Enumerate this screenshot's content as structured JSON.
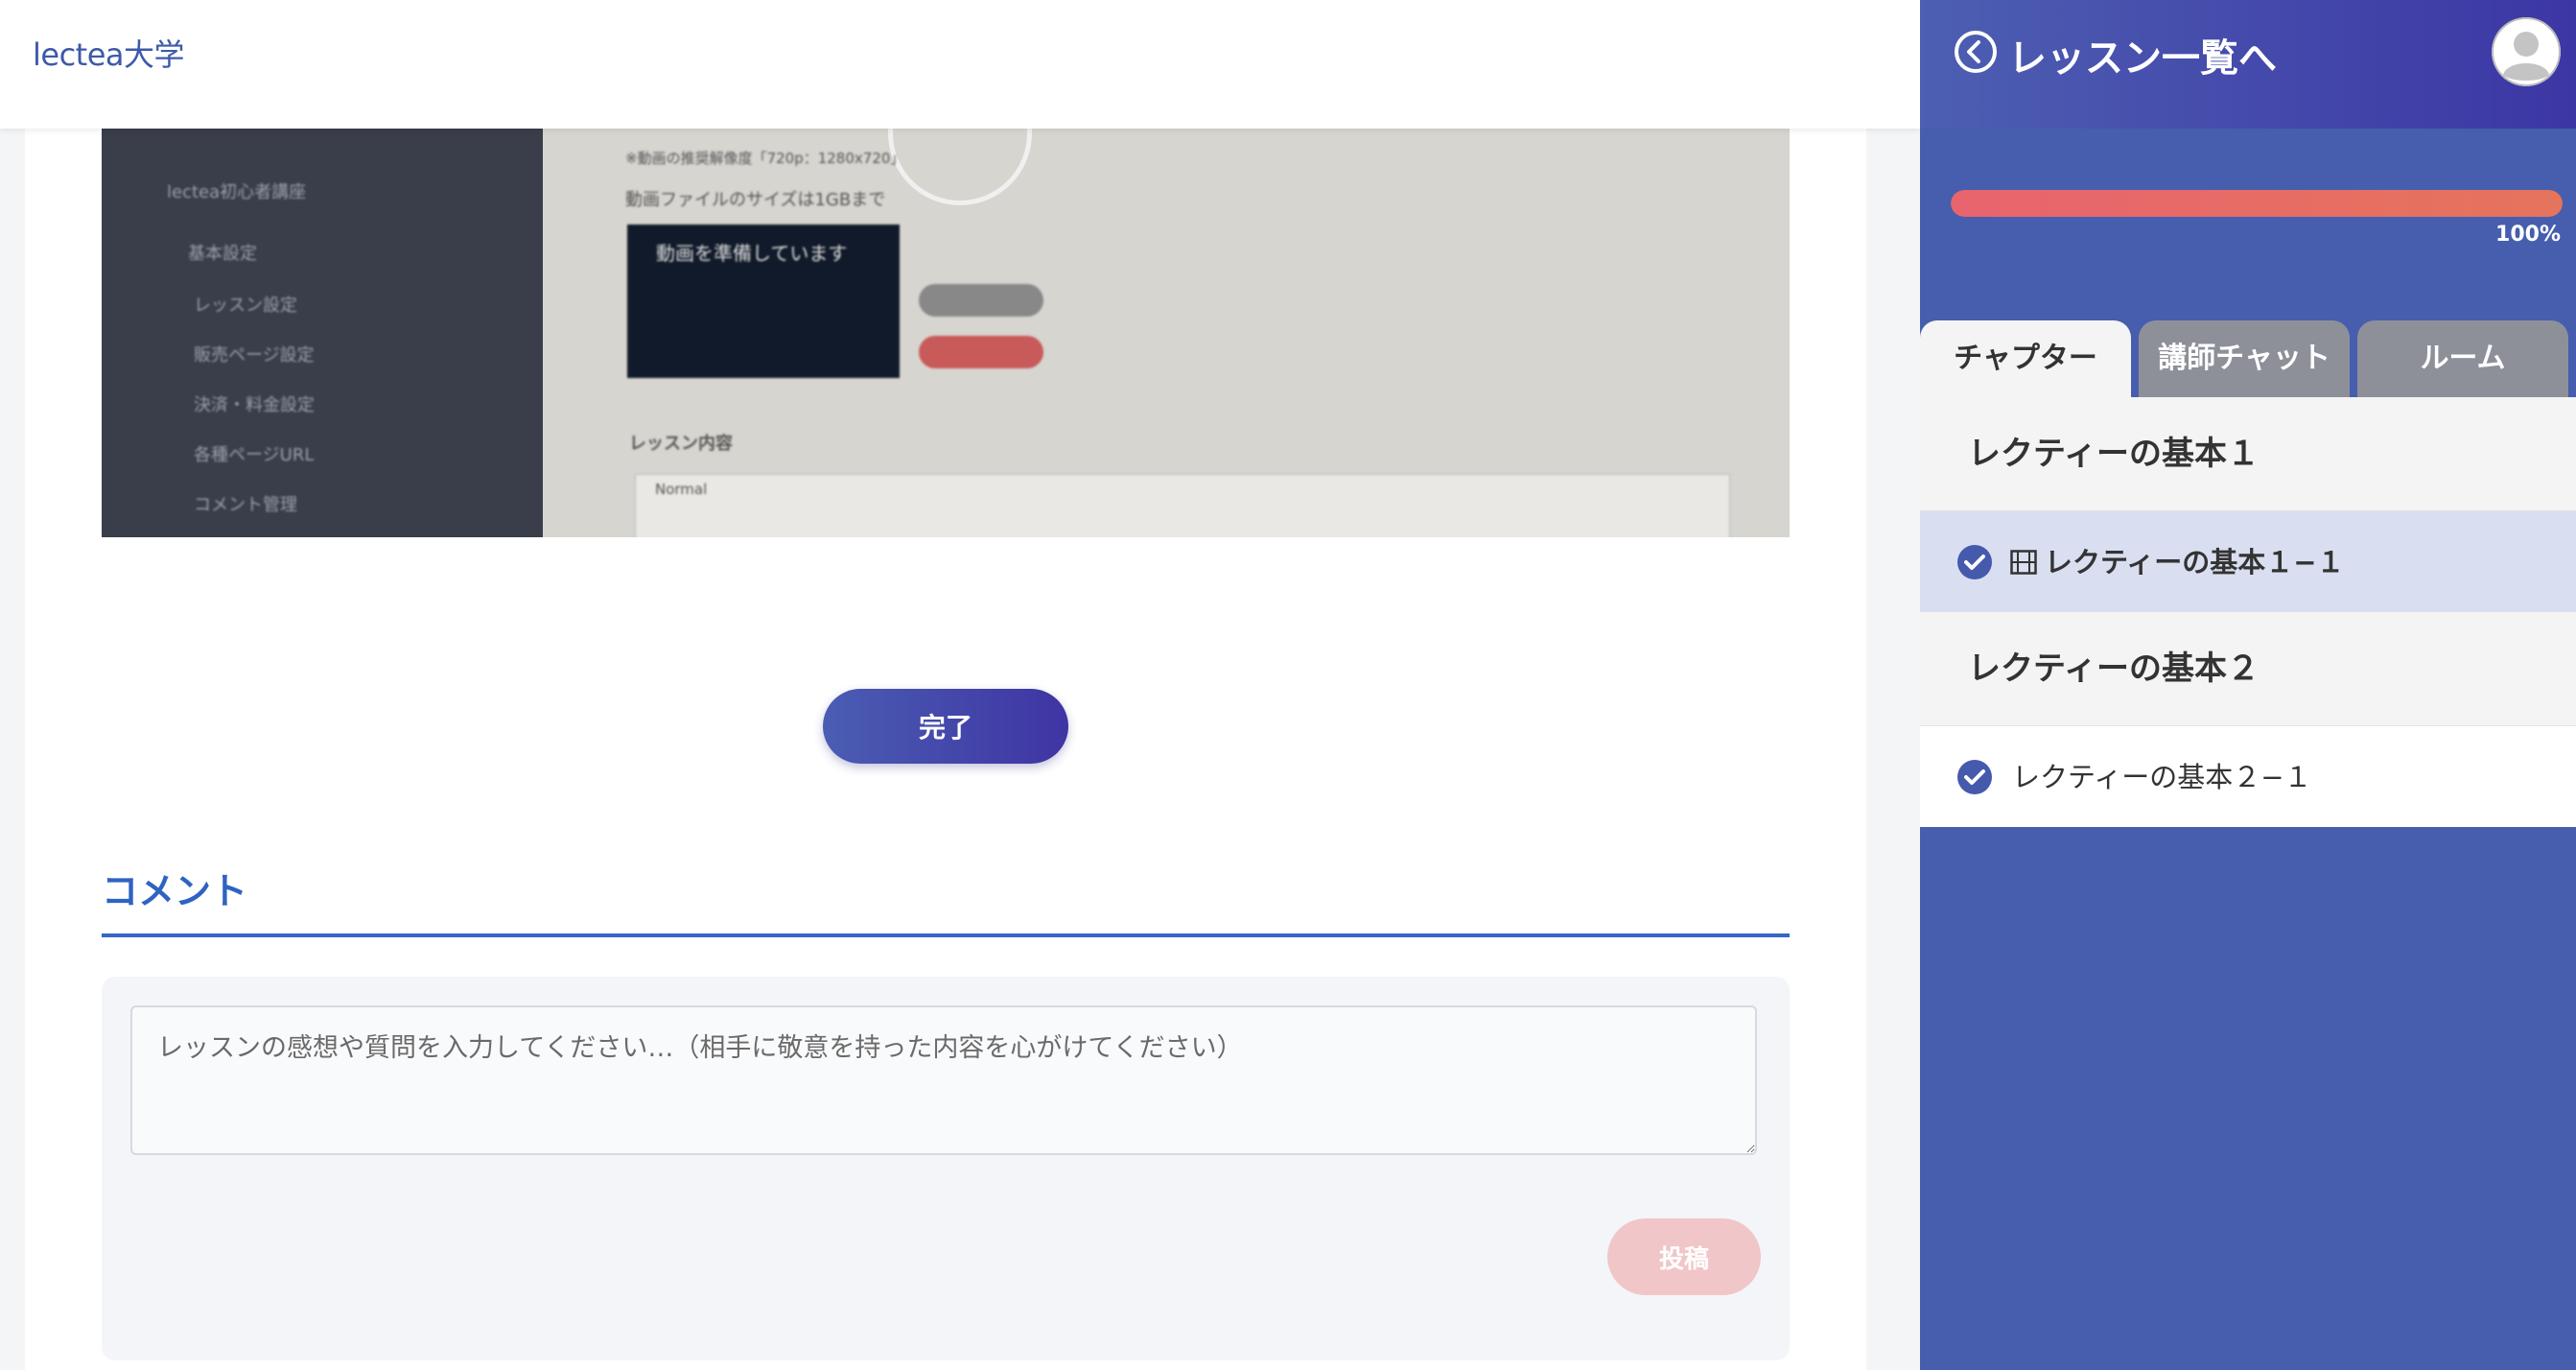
{
  "header": {
    "brand": "lectea大学"
  },
  "video": {
    "sidebar_items": [
      "lectea初心者講座",
      "基本設定",
      "レッスン設定",
      "販売ページ設定",
      "決済・料金設定",
      "各種ページURL",
      "コメント管理"
    ],
    "note_resolution": "※動画の推奨解像度「720p：1280x720」",
    "note_filesize": "動画ファイルのサイズは1GBまで",
    "preparing": "動画を準備しています",
    "lesson_content_label": "レッスン内容",
    "editor_format": "Normal"
  },
  "main": {
    "done_label": "完了",
    "comment_heading": "コメント",
    "comment_placeholder": "レッスンの感想や質問を入力してください…（相手に敬意を持った内容を心がけてください）",
    "post_label": "投稿"
  },
  "panel": {
    "back_label": "レッスン一覧へ",
    "progress_label": "100%",
    "progress_value": 1.0,
    "tabs": [
      {
        "label": "チャプター",
        "active": true
      },
      {
        "label": "講師チャット",
        "active": false
      },
      {
        "label": "ルーム",
        "active": false
      }
    ],
    "chapters": [
      {
        "title": "レクティーの基本１",
        "lessons": [
          {
            "label": "レクティーの基本１−１",
            "completed": true,
            "current": true,
            "icon": "film-icon"
          }
        ]
      },
      {
        "title": "レクティーの基本２",
        "lessons": [
          {
            "label": "レクティーの基本２−１",
            "completed": true,
            "current": false
          }
        ]
      }
    ]
  },
  "colors": {
    "accent": "#465ead",
    "heading_blue": "#2f63c3",
    "progress": "#e8646e",
    "post_button": "#f1c6c8"
  }
}
